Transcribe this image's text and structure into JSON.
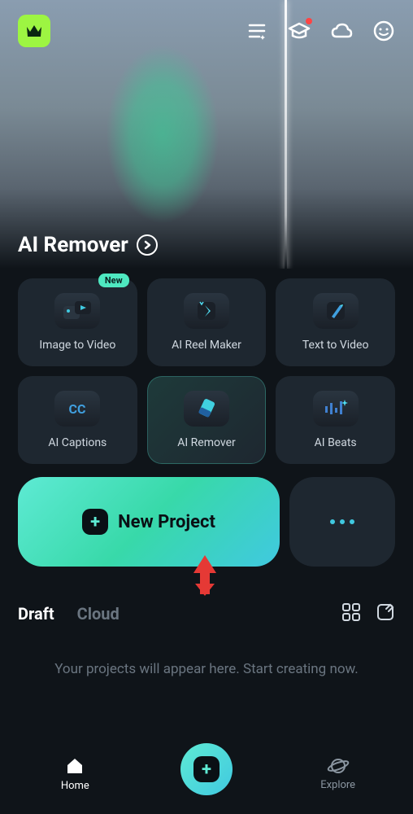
{
  "hero": {
    "title": "AI Remover"
  },
  "features": [
    {
      "label": "Image to Video",
      "badge": "New"
    },
    {
      "label": "AI Reel Maker"
    },
    {
      "label": "Text to Video"
    },
    {
      "label": "AI Captions"
    },
    {
      "label": "AI Remover",
      "active": true
    },
    {
      "label": "AI Beats"
    }
  ],
  "actions": {
    "new_project": "New Project"
  },
  "tabs": {
    "draft": "Draft",
    "cloud": "Cloud"
  },
  "empty_message": "Your projects will appear here. Start creating now.",
  "nav": {
    "home": "Home",
    "explore": "Explore"
  }
}
